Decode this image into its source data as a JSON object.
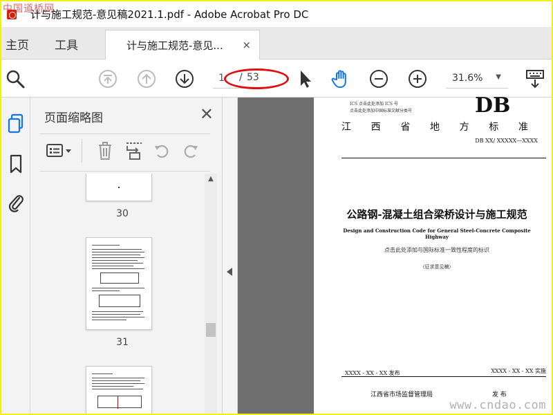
{
  "window": {
    "title": "计与施工规范-意见稿2021.1.pdf - Adobe Acrobat Pro DC",
    "watermark_top": "中国道桥网"
  },
  "tabs": {
    "home": "主页",
    "tools": "工具",
    "document": "计与施工规范-意见...",
    "close": "×"
  },
  "toolbar": {
    "current_page": "1",
    "separator": "/",
    "total_pages": "53",
    "zoom": "31.6%",
    "zoom_caret": "▼"
  },
  "thumbnails_panel": {
    "title": "页面缩略图",
    "close": "✕",
    "pages": [
      "30",
      "31"
    ]
  },
  "document_page": {
    "ics_line": "ICS  点击此处添加 ICS 号",
    "class_line": "点击此处添加中国标准文献分类号",
    "db_mark": "DB",
    "standard_chars": [
      "江",
      "西",
      "省",
      "地",
      "方",
      "标",
      "准"
    ],
    "code": "DB XX/ XXXXX—XXXX",
    "title_cn": "公路钢-混凝土组合梁桥设计与施工规范",
    "title_en": "Design and Construction Code for General Steel-Concrete Composite Highway",
    "consistency_note": "点击此处添加与国际标准一致性程度的标识",
    "draft_note": "（征求意见稿）",
    "publish_date": "XXXX - XX - XX 发布",
    "implement_date": "XXXX - XX - XX 实施",
    "issuer": "江西省市场监督管理局",
    "issue": "发 布"
  },
  "watermark_bottom": "www.cndao.com",
  "colors": {
    "border_yellow": "#f4f00e",
    "annotation_red": "#e01010",
    "hand_tool_blue": "#1473e6"
  }
}
